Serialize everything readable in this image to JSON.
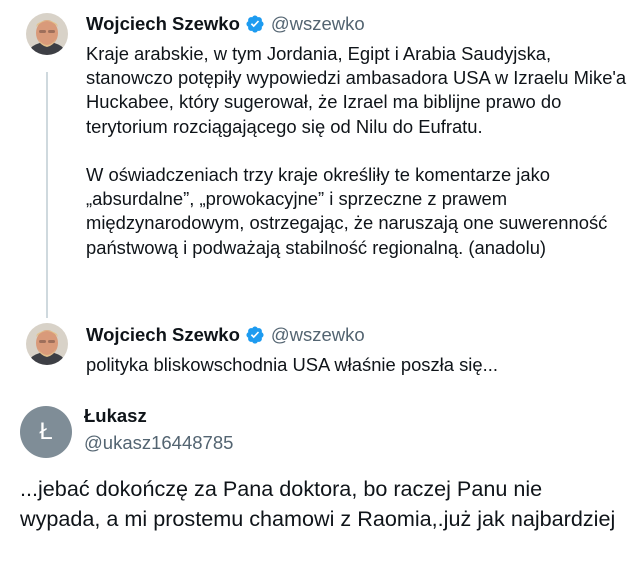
{
  "thread": {
    "tweets": [
      {
        "author_name": "Wojciech Szewko",
        "handle": "@wszewko",
        "verified": true,
        "paragraphs": [
          "Kraje arabskie, w tym Jordania, Egipt i Arabia Saudyjska, stanowczo potępiły wypowiedzi ambasadora USA w Izraelu Mike'a Huckabee, który sugerował, że Izrael ma biblijne prawo do terytorium rozciągającego się od Nilu do Eufratu.",
          "W oświadczeniach trzy kraje określiły te komentarze jako „absurdalne”, „prowokacyjne” i sprzeczne z prawem międzynarodowym, ostrzegając, że naruszają one suwerenność państwową i podważają stabilność regionalną. (anadolu)"
        ]
      },
      {
        "author_name": "Wojciech Szewko",
        "handle": "@wszewko",
        "verified": true,
        "paragraphs": [
          "polityka bliskowschodnia USA właśnie poszła się..."
        ]
      }
    ]
  },
  "reply": {
    "avatar_letter": "Ł",
    "author_name": "Łukasz",
    "handle": "@ukasz16448785",
    "text": "...jebać dokończę za Pana doktora, bo raczej Panu nie wypada, a mi prostemu chamowi z Raomia,.już jak najbardziej"
  },
  "colors": {
    "verified_badge": "#1d9bf0",
    "handle_gray": "#536471",
    "thread_line": "#cfd9de",
    "reply_avatar_bg": "#7f8d97"
  },
  "icons": {
    "verified": "verified-badge-icon",
    "avatar": "profile-photo"
  }
}
